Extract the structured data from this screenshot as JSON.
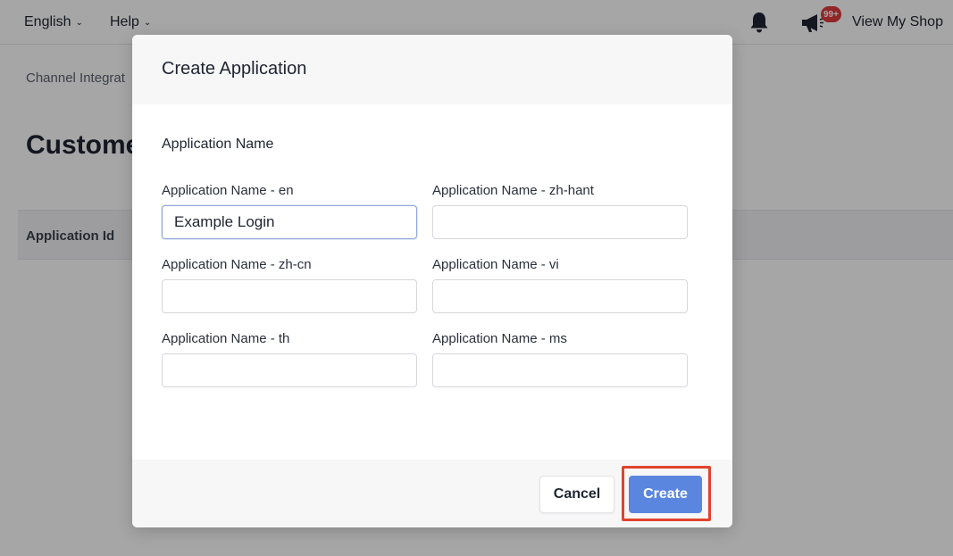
{
  "topbar": {
    "language_label": "English",
    "help_label": "Help",
    "notification_badge": "99+",
    "view_shop_label": "View My Shop"
  },
  "page": {
    "breadcrumb": "Channel Integrat",
    "title": "Custome",
    "table_columns": [
      "Application Id"
    ]
  },
  "modal": {
    "title": "Create Application",
    "section_label": "Application Name",
    "fields": [
      {
        "label": "Application Name - en",
        "value": "Example Login"
      },
      {
        "label": "Application Name - zh-hant",
        "value": ""
      },
      {
        "label": "Application Name - zh-cn",
        "value": ""
      },
      {
        "label": "Application Name - vi",
        "value": ""
      },
      {
        "label": "Application Name - th",
        "value": ""
      },
      {
        "label": "Application Name - ms",
        "value": ""
      }
    ],
    "cancel_label": "Cancel",
    "create_label": "Create"
  },
  "colors": {
    "primary": "#5a86e0",
    "highlight": "#e0442c",
    "badge": "#e03a3a"
  },
  "icons": [
    "chevron-down-icon",
    "bell-icon",
    "megaphone-icon"
  ]
}
